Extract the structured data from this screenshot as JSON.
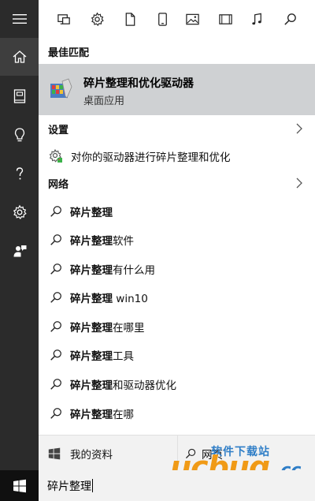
{
  "rail": {
    "items": [
      {
        "name": "menu-icon",
        "active": false
      },
      {
        "name": "home-icon",
        "active": true
      },
      {
        "name": "notebook-icon",
        "active": false
      },
      {
        "name": "lightbulb-icon",
        "active": false
      },
      {
        "name": "help-icon",
        "active": false
      },
      {
        "name": "gear-icon",
        "active": false
      },
      {
        "name": "feedback-icon",
        "active": false
      }
    ]
  },
  "filters": [
    "apps-icon",
    "settings-icon",
    "document-icon",
    "phone-icon",
    "photo-icon",
    "video-icon",
    "music-icon",
    "search-icon"
  ],
  "best_match": {
    "header": "最佳匹配",
    "title": "碎片整理和优化驱动器",
    "subtitle": "桌面应用"
  },
  "settings": {
    "header": "设置",
    "item": "对你的驱动器进行碎片整理和优化"
  },
  "web": {
    "header": "网络",
    "items": [
      {
        "bold": "碎片整理",
        "rest": ""
      },
      {
        "bold": "碎片整理",
        "rest": "软件"
      },
      {
        "bold": "碎片整理",
        "rest": "有什么用"
      },
      {
        "bold": "碎片整理",
        "rest": " win10"
      },
      {
        "bold": "碎片整理",
        "rest": "在哪里"
      },
      {
        "bold": "碎片整理",
        "rest": "工具"
      },
      {
        "bold": "碎片整理",
        "rest": "和驱动器优化"
      },
      {
        "bold": "碎片整理",
        "rest": "在哪"
      }
    ]
  },
  "bottom": {
    "my_stuff": "我的资料",
    "web": "网页"
  },
  "search": {
    "value": "碎片整理"
  },
  "watermark": {
    "top": "软件下载站",
    "logo": "ucbug",
    "suffix": ".cc"
  },
  "colors": {
    "rail": "#2b2b2b",
    "taskbar": "#101010",
    "selected": "#cfd1d3",
    "watermark_orange": "#f09a16",
    "watermark_blue": "#2f7ec7"
  }
}
